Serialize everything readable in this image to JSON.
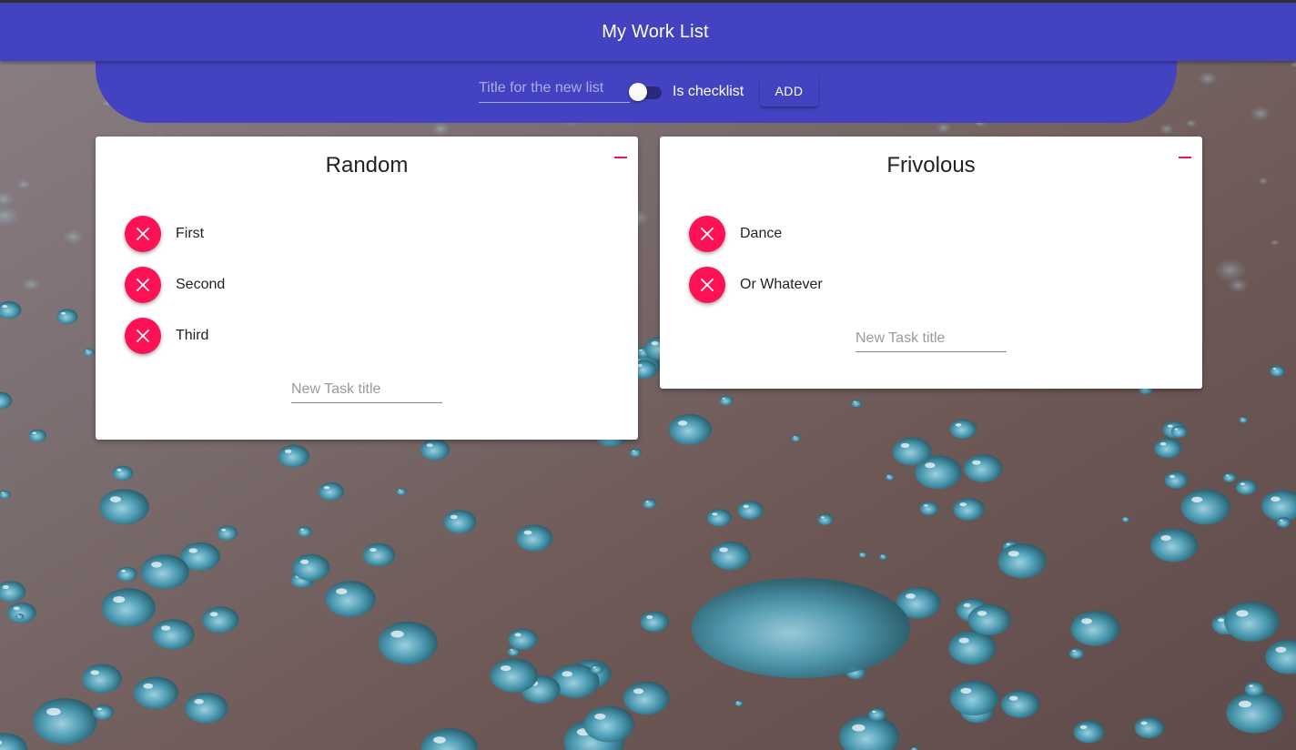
{
  "app": {
    "title": "My Work List"
  },
  "new_list": {
    "title_placeholder": "Title for the new list",
    "title_value": "",
    "checklist_label": "Is checklist",
    "checklist_on": false,
    "add_label": "ADD"
  },
  "colors": {
    "primary": "#4343c2",
    "accent": "#ff1155",
    "card": "#ffffff"
  },
  "icons": {
    "remove_list": "minus-icon",
    "delete_task": "close-icon"
  },
  "lists": [
    {
      "title": "Random",
      "tasks": [
        "First",
        "Second",
        "Third"
      ],
      "new_task_placeholder": "New Task title"
    },
    {
      "title": "Frivolous",
      "tasks": [
        "Dance",
        "Or Whatever"
      ],
      "new_task_placeholder": "New Task title"
    }
  ]
}
